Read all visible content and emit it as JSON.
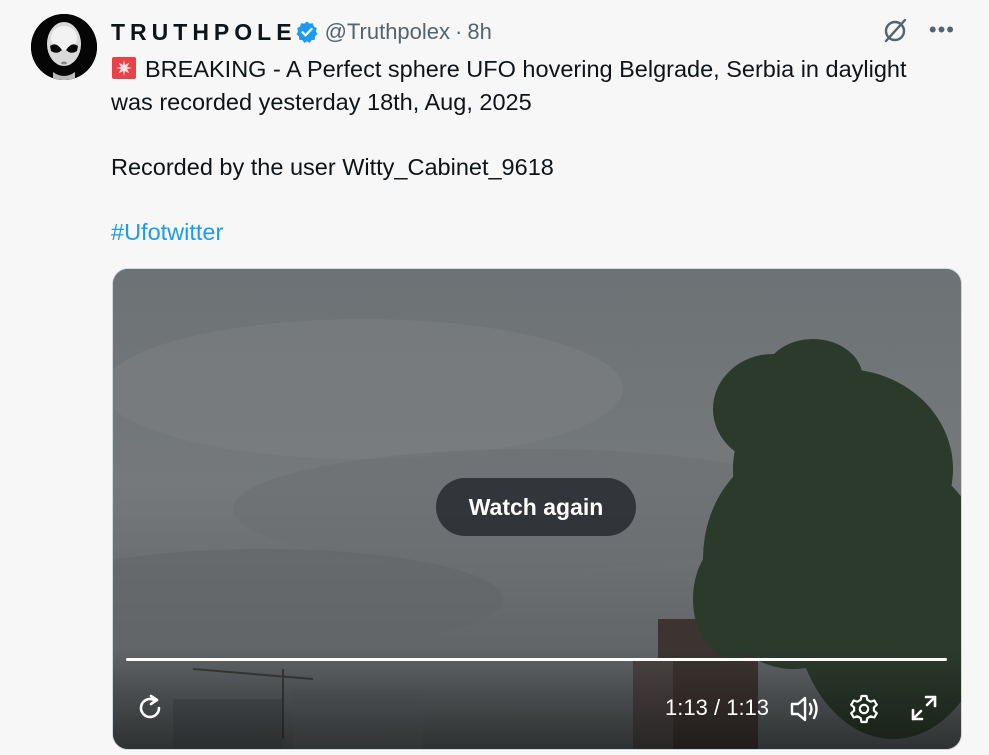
{
  "author": {
    "display_name": "TRUTHPOLE",
    "handle": "@Truthpolex",
    "separator": "·",
    "time": "8h"
  },
  "post": {
    "line1": "BREAKING - A Perfect sphere UFO hovering  Belgrade, Serbia in daylight",
    "line2": "was recorded yesterday 18th, Aug, 2025",
    "line3": "Recorded by the user Witty_Cabinet_9618",
    "hashtag": "#Ufotwitter",
    "emoji_icon": "siren-icon"
  },
  "video": {
    "watch_again_label": "Watch again",
    "current_time": "1:13",
    "separator": "/",
    "duration": "1:13",
    "progress": 1.0
  },
  "icons": {
    "more": "•••",
    "grok": "grok-icon",
    "replay": "replay-icon",
    "volume": "volume-icon",
    "settings": "gear-icon",
    "fullscreen": "fullscreen-icon"
  },
  "colors": {
    "link": "#1d9bf0",
    "verified": "#1d9bf0",
    "text": "#0f1419",
    "muted": "#536471"
  }
}
